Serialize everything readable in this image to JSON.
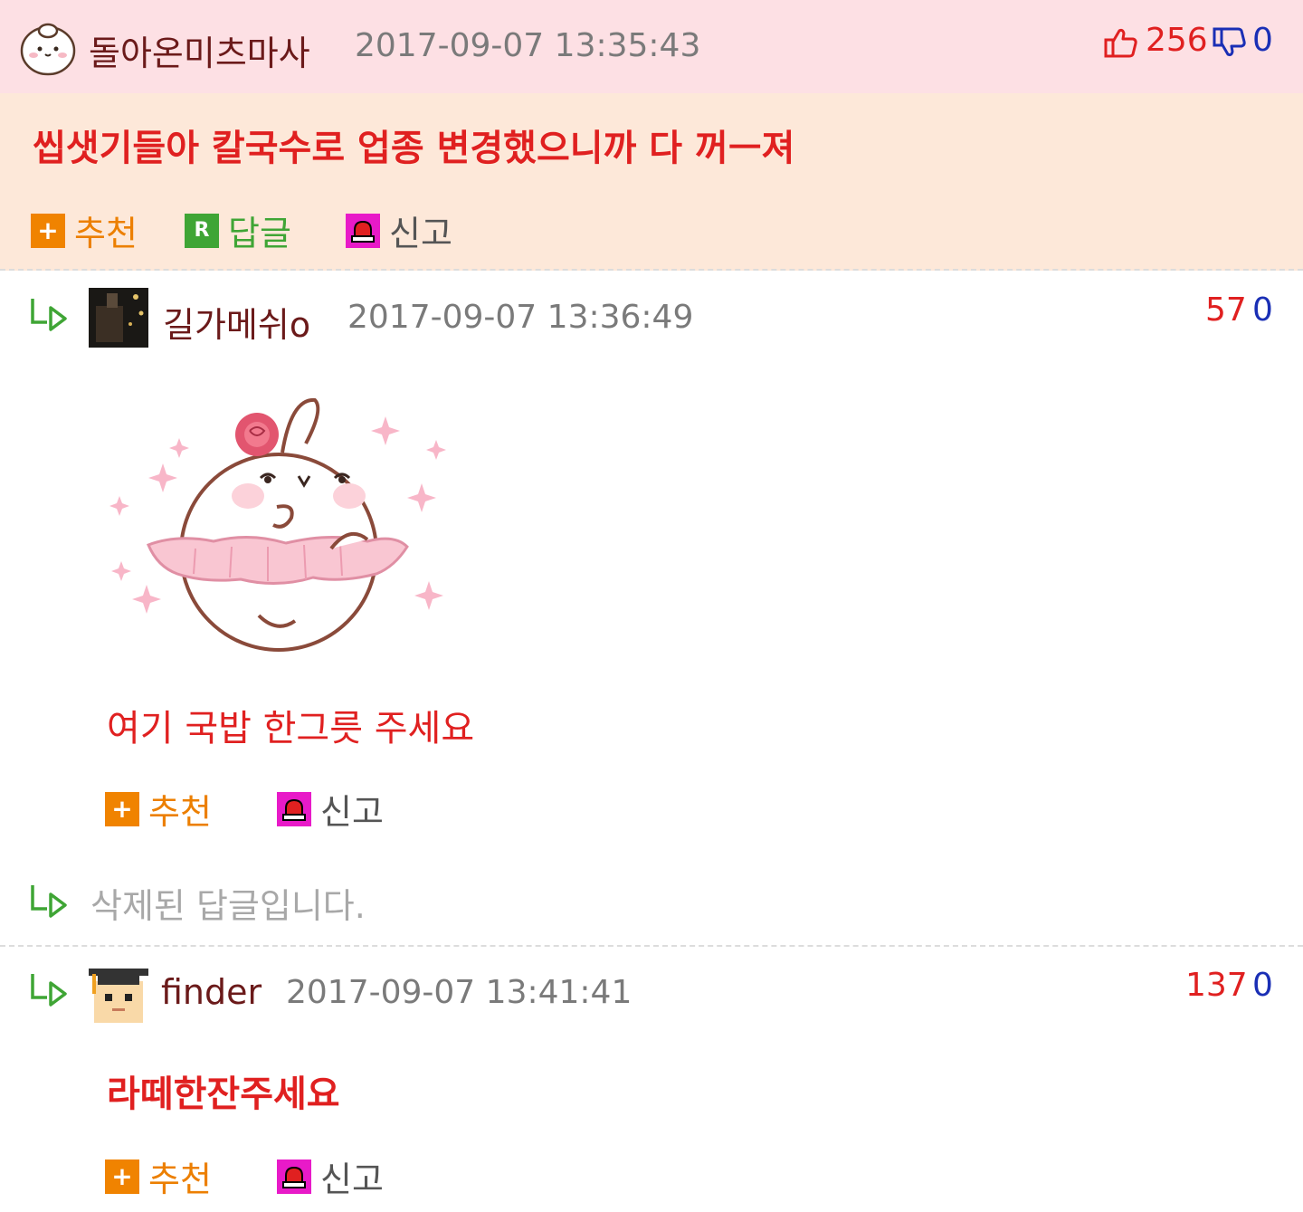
{
  "post": {
    "author": "돌아온미츠마사",
    "date": "2017-09-07 13:35:43",
    "up_count": "256",
    "down_count": "0",
    "text": "씹샛기들아 칼국수로 업종 변경했으니까 다 꺼ㅡ져",
    "actions": {
      "recommend": "추천",
      "reply": "답글",
      "report": "신고"
    },
    "icon_badges": {
      "reply_badge": "R"
    }
  },
  "comments": [
    {
      "author": "길가메쉬o",
      "date": "2017-09-07 13:36:49",
      "up_count": "57",
      "down_count": "0",
      "text": "여기 국밥 한그릇 주세요",
      "actions": {
        "recommend": "추천",
        "report": "신고"
      }
    },
    {
      "deleted_text": "삭제된 답글입니다."
    },
    {
      "author": "finder",
      "date": "2017-09-07 13:41:41",
      "up_count": "137",
      "down_count": "0",
      "text": "라떼한잔주세요",
      "actions": {
        "recommend": "추천",
        "report": "신고"
      }
    }
  ],
  "colors": {
    "header_bg": "#fde0e4",
    "post_body_bg": "#fde8d9",
    "accent_red": "#e02020",
    "down_blue": "#1a2fb5",
    "recommend_orange": "#f08300",
    "reply_green": "#3fa535",
    "report_magenta": "#e81ac8"
  },
  "icons": [
    "avatar-mochi-icon",
    "thumbs-up-icon",
    "thumbs-down-icon",
    "plus-icon",
    "reply-badge-icon",
    "siren-icon",
    "reply-arrow-icon",
    "avatar-photo",
    "avatar-graduate-icon",
    "sticker-mochi-ballerina"
  ]
}
